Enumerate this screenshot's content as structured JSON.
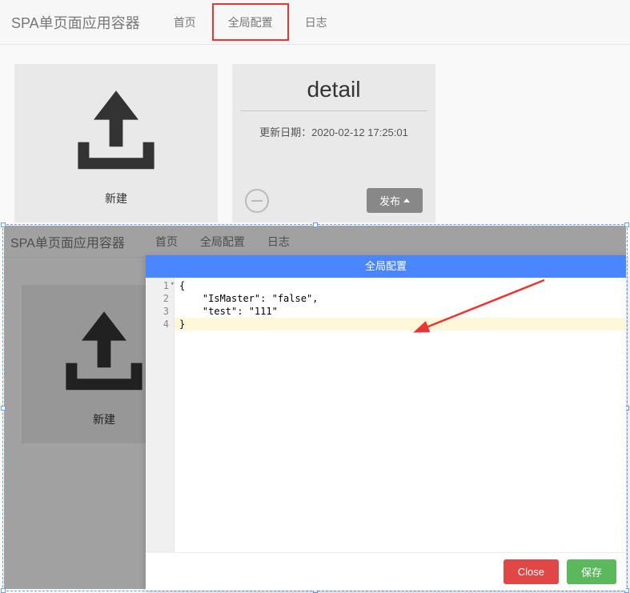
{
  "header": {
    "app_title": "SPA单页面应用容器",
    "tabs": [
      {
        "label": "首页",
        "active": false
      },
      {
        "label": "全局配置",
        "active": false,
        "highlight": true
      },
      {
        "label": "日志",
        "active": false
      }
    ]
  },
  "cards": {
    "new_label": "新建",
    "detail": {
      "title": "detail",
      "date_label": "更新日期：2020-02-12 17:25:01",
      "publish_label": "发布",
      "minus_name": "minus-icon"
    }
  },
  "modal": {
    "title": "全局配置",
    "close_label": "Close",
    "save_label": "保存",
    "editor": {
      "lines": [
        {
          "num": "1",
          "content": "{"
        },
        {
          "num": "2",
          "content": "    \"IsMaster\": \"false\","
        },
        {
          "num": "3",
          "content": "    \"test\": \"111\""
        },
        {
          "num": "4",
          "content": "}",
          "highlight": true
        }
      ]
    },
    "config_json": {
      "IsMaster": "false",
      "test": "111"
    }
  },
  "colors": {
    "highlight_border": "#e33",
    "modal_title_bg": "#4a86ff",
    "btn_close": "#e04848",
    "btn_save": "#5cb85c"
  }
}
